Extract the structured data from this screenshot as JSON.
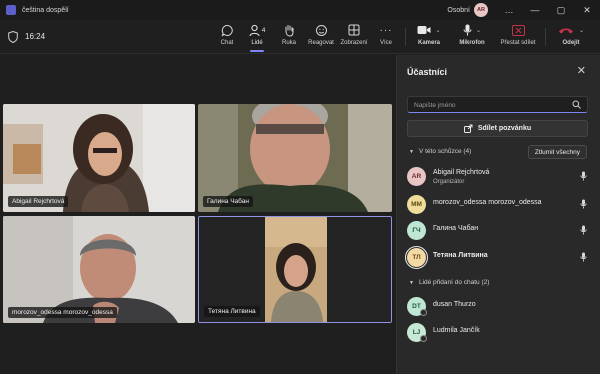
{
  "window": {
    "title": "čeština dospělí",
    "profile_label": "Osobní",
    "profile_initials": "AR"
  },
  "toolbar": {
    "timer": "16:24",
    "chat": "Chat",
    "people": "Lidé",
    "people_count": "4",
    "hand": "Ruka",
    "react": "Reagovat",
    "view": "Zobrazení",
    "more": "Více",
    "camera": "Kamera",
    "mic": "Mikrofon",
    "share": "Přestat sdílet",
    "leave": "Odejít"
  },
  "tiles": [
    {
      "name": "Abigail Rejchrtová"
    },
    {
      "name": "Галина Чабан"
    },
    {
      "name": "morozov_odessa morozov_odessa"
    },
    {
      "name": "Тетяна Литвина"
    }
  ],
  "panel": {
    "title": "Účastníci",
    "search_placeholder": "Napište jméno",
    "share_invite": "Sdílet pozvánku",
    "in_meeting_header": "V této schůzce (4)",
    "mute_all": "Ztlumit všechny",
    "chat_header": "Lidé přidaní do chatu (2)",
    "in_meeting": [
      {
        "initials": "AR",
        "name": "Abigail Rejchrtová",
        "role": "Organizátor",
        "color": "#e8c6c6",
        "text_color": "#6b2a2a"
      },
      {
        "initials": "MM",
        "name": "morozov_odessa morozov_odessa",
        "role": "",
        "color": "#efdc9a",
        "text_color": "#5c4a10"
      },
      {
        "initials": "ГЧ",
        "name": "Галина Чабан",
        "role": "",
        "color": "#bfe6d4",
        "text_color": "#1d5a3f"
      },
      {
        "initials": "ТЛ",
        "name": "Тетяна Литвина",
        "role": "",
        "color": "#f2d9a6",
        "text_color": "#6a4a12"
      }
    ],
    "in_chat": [
      {
        "initials": "DT",
        "name": "dusan Thurzo",
        "color": "#bfe6d4",
        "text_color": "#1d5a3f"
      },
      {
        "initials": "LJ",
        "name": "Ludmila Jančík",
        "color": "#c8e8d6",
        "text_color": "#1d5a3f"
      }
    ]
  },
  "colors": {
    "accent": "#7f85f5",
    "leave_red": "#c4314b"
  }
}
